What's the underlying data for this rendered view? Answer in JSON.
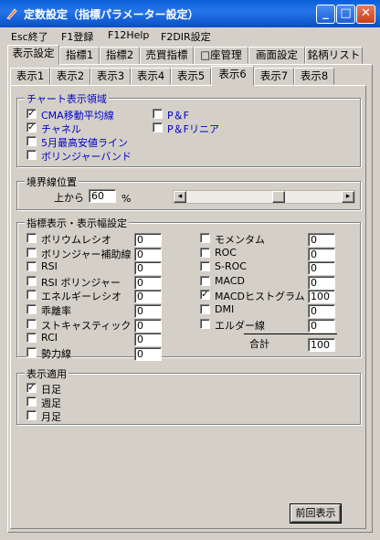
{
  "window": {
    "title": "定数設定（指標パラメーター設定）",
    "btn_min": "_",
    "btn_max": "□",
    "btn_close": "✕"
  },
  "menu": [
    "Esc終了",
    "F1登録",
    "F12Help",
    "F2DIR設定"
  ],
  "tabs_main": [
    "表示設定",
    "指標1",
    "指標2",
    "売買指標",
    "□座管理",
    "画面設定",
    "銘柄リスト"
  ],
  "tabs_sub": [
    "表示1",
    "表示2",
    "表示3",
    "表示4",
    "表示5",
    "表示6",
    "表示7",
    "表示8"
  ],
  "chart_area": {
    "title": "チャート表示領域",
    "items": [
      {
        "label": "CMA移動平均線",
        "checked": true
      },
      {
        "label": "チャネル",
        "checked": true
      },
      {
        "label": "5月最高安値ライン",
        "checked": false
      },
      {
        "label": "ボリンジャーバンド",
        "checked": false
      },
      {
        "label": "P＆F",
        "checked": false
      },
      {
        "label": "P＆Fリニア",
        "checked": false
      }
    ]
  },
  "boundary": {
    "title": "境界線位置",
    "prefix": "上から",
    "value": "60",
    "unit": "%",
    "slider_fraction": 0.6,
    "left_arrow": "◂",
    "right_arrow": "▸"
  },
  "indicators": {
    "title": "指標表示・表示幅設定",
    "left": [
      {
        "label": "ボリウムレシオ",
        "checked": false,
        "value": "0"
      },
      {
        "label": "ボリンジャー補助線",
        "checked": false,
        "value": "0"
      },
      {
        "label": "RSI",
        "checked": false,
        "value": "0"
      },
      {
        "label": "RSI ボリンジャー",
        "checked": false,
        "value": "0"
      },
      {
        "label": "エネルギーレシオ",
        "checked": false,
        "value": "0"
      },
      {
        "label": "乖離率",
        "checked": false,
        "value": "0"
      },
      {
        "label": "ストキャスティック",
        "checked": false,
        "value": "0"
      },
      {
        "label": "RCI",
        "checked": false,
        "value": "0"
      },
      {
        "label": "勢力線",
        "checked": false,
        "value": "0"
      }
    ],
    "right": [
      {
        "label": "モメンタム",
        "checked": false,
        "value": "0"
      },
      {
        "label": "ROC",
        "checked": false,
        "value": "0"
      },
      {
        "label": "S-ROC",
        "checked": false,
        "value": "0"
      },
      {
        "label": "MACD",
        "checked": false,
        "value": "0"
      },
      {
        "label": "MACDヒストグラム",
        "checked": true,
        "value": "100"
      },
      {
        "label": "DMI",
        "checked": false,
        "value": "0"
      },
      {
        "label": "エルダー線",
        "checked": false,
        "value": "0"
      }
    ],
    "total_label": "合計",
    "total_value": "100"
  },
  "display_apply": {
    "title": "表示適用",
    "items": [
      {
        "label": "日足",
        "checked": true
      },
      {
        "label": "週足",
        "checked": false
      },
      {
        "label": "月足",
        "checked": false
      }
    ]
  },
  "prev_button": "前回表示",
  "check_mark": "✓"
}
